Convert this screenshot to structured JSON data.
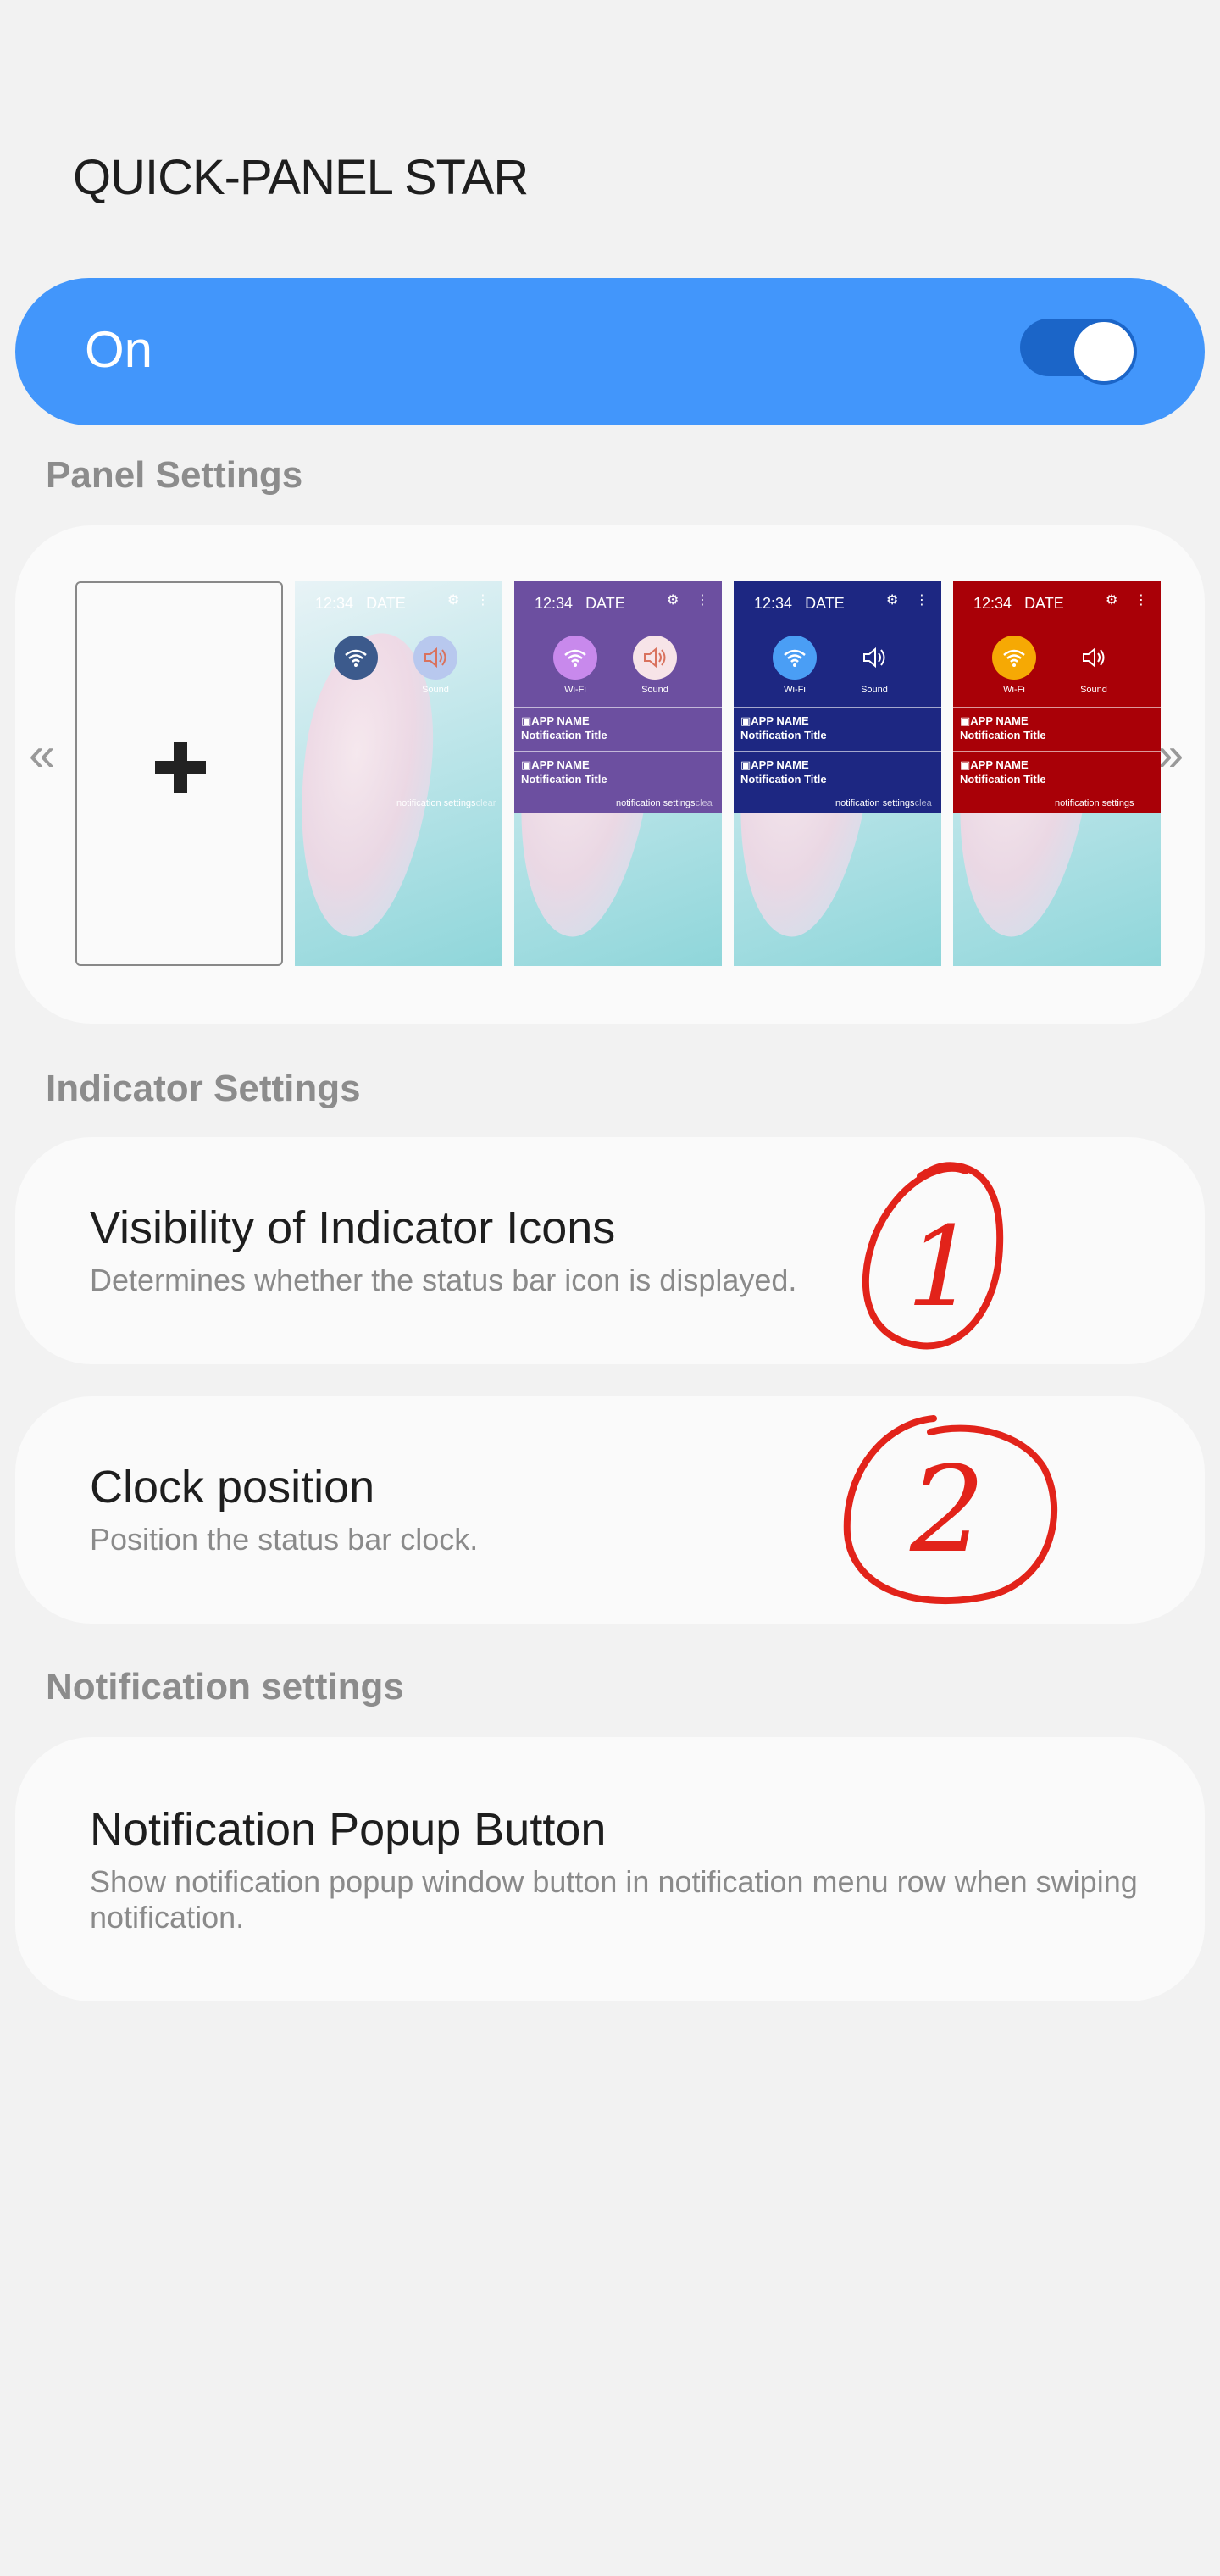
{
  "header": {
    "title": "QUICK-PANEL STAR"
  },
  "master_switch": {
    "label": "On",
    "enabled": true,
    "accent": "#4296fb"
  },
  "sections": {
    "panel": "Panel Settings",
    "indicator": "Indicator Settings",
    "notification": "Notification settings"
  },
  "carousel": {
    "prev_icon": "«",
    "next_icon": "»",
    "add_icon": "plus-icon",
    "themes": [
      {
        "time": "12:34",
        "date": "DATE",
        "shade": "transparent",
        "wifi_bg": "#3c5a8c",
        "sound_bg": "#b8c8ee",
        "show_notifs": false,
        "wifi_label": "",
        "sound_label": "Sound",
        "footer": "notification settings",
        "footer_tail": "clear"
      },
      {
        "time": "12:34",
        "date": "DATE",
        "shade": "#6c4fa0",
        "wifi_bg": "#c889ec",
        "sound_bg": "#f7e4e8",
        "show_notifs": true,
        "wifi_label": "Wi-Fi",
        "sound_label": "Sound",
        "footer": "notification settings",
        "footer_tail": "clea"
      },
      {
        "time": "12:34",
        "date": "DATE",
        "shade": "#1d2782",
        "wifi_bg": "#4a9ef5",
        "sound_bg": "transparent",
        "show_notifs": true,
        "wifi_label": "Wi-Fi",
        "sound_label": "Sound",
        "footer": "notification settings",
        "footer_tail": "clea"
      },
      {
        "time": "12:34",
        "date": "DATE",
        "shade": "#a90007",
        "wifi_bg": "#f6a904",
        "sound_bg": "transparent",
        "show_notifs": true,
        "wifi_label": "Wi-Fi",
        "sound_label": "Sound",
        "footer": "notification settings",
        "footer_tail": ""
      }
    ],
    "notif_app": "APP NAME",
    "notif_title": "Notification Title"
  },
  "settings": {
    "visibility": {
      "title": "Visibility of Indicator Icons",
      "desc": "Determines whether the status bar icon is displayed."
    },
    "clock": {
      "title": "Clock position",
      "desc": "Position the status bar clock."
    },
    "popup": {
      "title": "Notification Popup Button",
      "desc": "Show notification popup window button in notification menu row when swiping notification."
    }
  },
  "annotations": {
    "one": "1",
    "two": "2",
    "color": "#e2231a"
  }
}
